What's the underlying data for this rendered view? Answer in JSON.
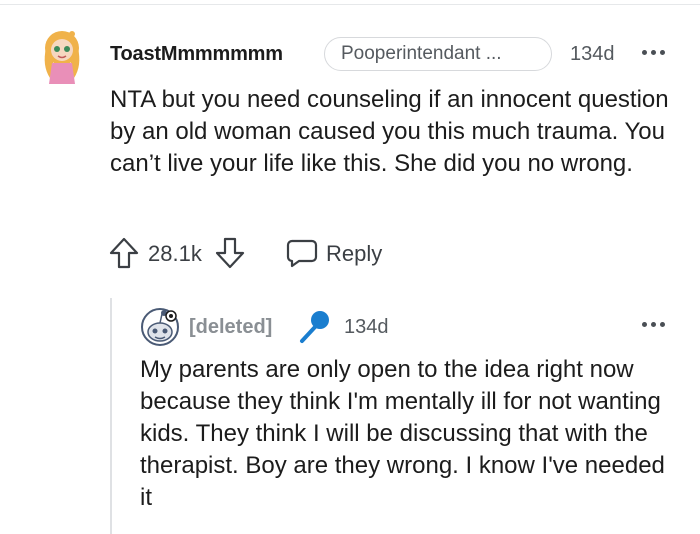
{
  "comment": {
    "username": "ToastMmmmmmm",
    "flair": "Pooperintendant ...",
    "age": "134d",
    "body": "NTA but you need counseling if an innocent question by an old woman caused you this much trauma. You can’t live your life like this. She did you no wrong.",
    "vote_count": "28.1k",
    "reply_label": "Reply"
  },
  "reply": {
    "username": "[deleted]",
    "age": "134d",
    "body": "My parents are only open to the idea right now because they think I'm mentally ill for not wanting kids. They think I will be discussing that with the therapist. Boy are they wrong. I know I've needed it"
  },
  "icons": {
    "avatar": "cartoon-girl-avatar-icon",
    "upvote": "arrow-up-icon",
    "downvote": "arrow-down-icon",
    "reply": "speech-bubble-icon",
    "more": "ellipsis-icon",
    "deleted_avatar": "snoo-avatar-icon",
    "mic": "microphone-icon"
  },
  "colors": {
    "text": "#1c1c1c",
    "meta": "#555a5f",
    "muted": "#8a8f94",
    "mic": "#1a7ecf"
  }
}
